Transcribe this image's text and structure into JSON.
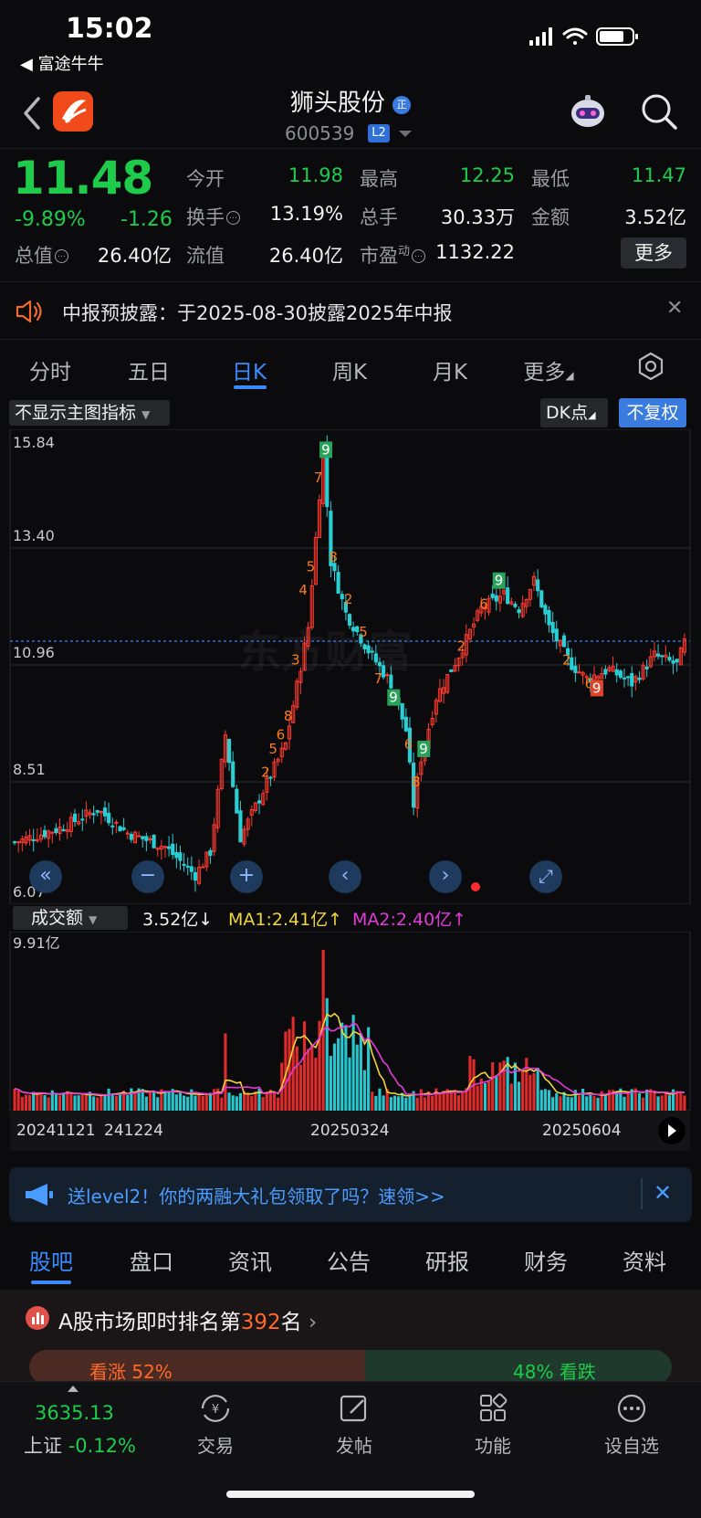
{
  "status_bar": {
    "time": "15:02",
    "back_app": "◀ 富途牛牛"
  },
  "header": {
    "stock_name": "狮头股份",
    "code": "600539",
    "badge": "L2",
    "official_badge": "正"
  },
  "quote": {
    "price": "11.48",
    "change_pct": "-9.89%",
    "change": "-1.26",
    "fields": [
      {
        "label": "今开",
        "value": "11.98",
        "color": "green"
      },
      {
        "label": "最高",
        "value": "12.25",
        "color": "green"
      },
      {
        "label": "最低",
        "value": "11.47",
        "color": "green"
      },
      {
        "label": "换手",
        "value": "13.19%",
        "color": "white"
      },
      {
        "label": "总手",
        "value": "30.33万",
        "color": "white"
      },
      {
        "label": "金额",
        "value": "3.52亿",
        "color": "white"
      },
      {
        "label": "总值",
        "value": "26.40亿",
        "color": "white"
      },
      {
        "label": "流值",
        "value": "26.40亿",
        "color": "white"
      },
      {
        "label": "市盈",
        "label_sup": "动",
        "value": "1132.22",
        "color": "white"
      }
    ],
    "more_label": "更多"
  },
  "notice": {
    "text": "中报预披露：于2025-08-30披露2025年中报"
  },
  "period_tabs": [
    "分时",
    "五日",
    "日K",
    "周K",
    "月K",
    "更多"
  ],
  "active_period": 2,
  "chart_controls": {
    "indicator_select": "不显示主图指标",
    "dk_label": "DK点",
    "adjust_label": "不复权"
  },
  "chart_data": {
    "type": "candlestick",
    "y_ticks": [
      "15.84",
      "13.40",
      "10.96",
      "8.51",
      "6.07"
    ],
    "ylim": [
      6.07,
      15.84
    ],
    "x_labels": [
      "20241121",
      "241224",
      "20250324",
      "20250604"
    ],
    "reference_line": 11.48,
    "volume_label": "成交额",
    "volume_value": "3.52亿↓",
    "ma1": "MA1:2.41亿↑",
    "ma2": "MA2:2.40亿↑",
    "volume_max_label": "9.91亿",
    "watermark": "东方财富"
  },
  "chart_nav": [
    "«",
    "−",
    "+",
    "‹",
    "›",
    "⤢"
  ],
  "promo": {
    "text": "送level2！你的两融大礼包领取了吗？速领>>"
  },
  "content_tabs": [
    "股吧",
    "盘口",
    "资讯",
    "公告",
    "研报",
    "财务",
    "资料"
  ],
  "ranking": {
    "prefix": "A股市场即时排名第",
    "rank": "392",
    "suffix": "名",
    "bull": "看涨 52%",
    "bear": "48% 看跌"
  },
  "bottom_bar": {
    "index_value": "3635.13",
    "index_name": "上证",
    "index_change": "-0.12%",
    "nav": [
      "交易",
      "发帖",
      "功能",
      "设自选"
    ]
  }
}
